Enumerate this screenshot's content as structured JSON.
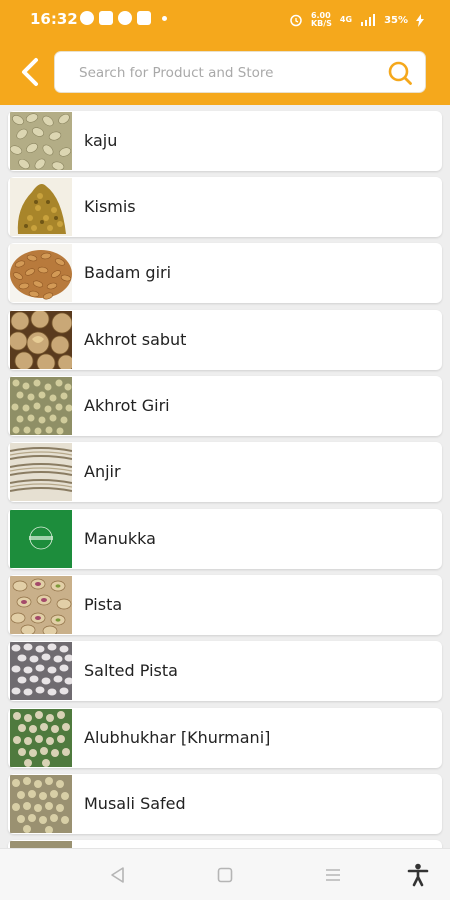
{
  "status": {
    "time": "16:32",
    "speed": "6.00",
    "speed_unit": "KB/S",
    "network": "4G",
    "battery": "35%"
  },
  "header": {
    "back_icon": "chevron-left-icon"
  },
  "search": {
    "placeholder": "Search for Product and Store",
    "value": ""
  },
  "products": [
    {
      "name": "kaju"
    },
    {
      "name": "Kismis"
    },
    {
      "name": "Badam giri"
    },
    {
      "name": "Akhrot sabut"
    },
    {
      "name": "Akhrot Giri"
    },
    {
      "name": "Anjir"
    },
    {
      "name": "Manukka"
    },
    {
      "name": "Pista"
    },
    {
      "name": "Salted Pista"
    },
    {
      "name": "Alubhukhar [Khurmani]"
    },
    {
      "name": "Musali Safed"
    }
  ],
  "colors": {
    "accent": "#f5a81c",
    "background": "#eeeeee"
  }
}
